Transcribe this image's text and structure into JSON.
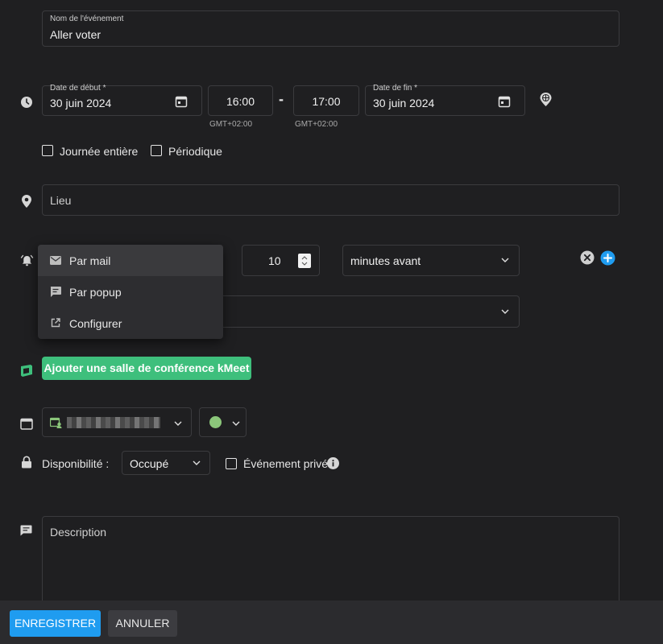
{
  "event": {
    "name_label": "Nom de l'événement",
    "name_value": "Aller voter"
  },
  "dates": {
    "start_label": "Date de début *",
    "start_value": "30 juin 2024",
    "start_time": "16:00",
    "dash": "-",
    "end_time": "17:00",
    "start_tz": "GMT+02:00",
    "end_tz": "GMT+02:00",
    "end_label": "Date de fin *",
    "end_value": "30 juin 2024"
  },
  "options": {
    "all_day": "Journée entière",
    "recurring": "Périodique"
  },
  "location": {
    "placeholder": "Lieu"
  },
  "reminder": {
    "amount": "10",
    "unit": "minutes avant",
    "menu": [
      {
        "label": "Par mail",
        "icon": "mail-icon"
      },
      {
        "label": "Par popup",
        "icon": "popup-icon"
      },
      {
        "label": "Configurer",
        "icon": "external-link-icon"
      }
    ]
  },
  "conference": {
    "button_label": "Ajouter une salle de conférence kMeet"
  },
  "calendar": {
    "color": "#8bc67a"
  },
  "availability": {
    "label": "Disponibilité :",
    "value": "Occupé",
    "private_label": "Événement privé"
  },
  "description": {
    "placeholder": "Description"
  },
  "footer": {
    "save": "ENREGISTRER",
    "cancel": "ANNULER"
  },
  "colors": {
    "accent": "#1f9cf0",
    "green": "#3ebf7c"
  }
}
